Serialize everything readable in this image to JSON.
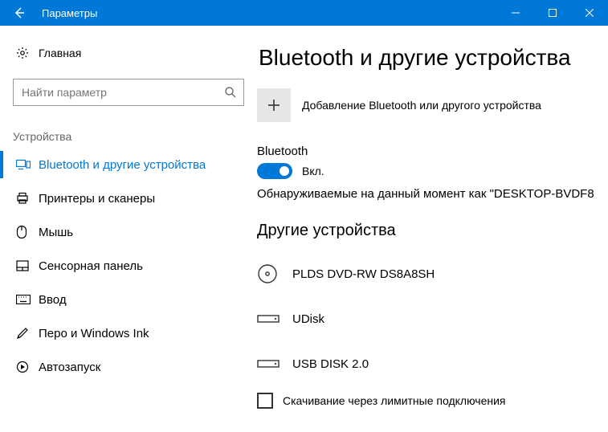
{
  "window": {
    "title": "Параметры"
  },
  "sidebar": {
    "home": "Главная",
    "search_placeholder": "Найти параметр",
    "category": "Устройства",
    "items": [
      {
        "label": "Bluetooth и другие устройства"
      },
      {
        "label": "Принтеры и сканеры"
      },
      {
        "label": "Мышь"
      },
      {
        "label": "Сенсорная панель"
      },
      {
        "label": "Ввод"
      },
      {
        "label": "Перо и Windows Ink"
      },
      {
        "label": "Автозапуск"
      }
    ]
  },
  "main": {
    "title": "Bluetooth и другие устройства",
    "add_label": "Добавление Bluetooth или другого устройства",
    "bt_label": "Bluetooth",
    "bt_state": "Вкл.",
    "discoverable": "Обнаруживаемые на данный момент как \"DESKTOP-BVDF8",
    "other_heading": "Другие устройства",
    "devices": [
      {
        "name": "PLDS DVD-RW DS8A8SH"
      },
      {
        "name": "UDisk"
      },
      {
        "name": "USB DISK 2.0"
      }
    ],
    "metered_label": "Скачивание через лимитные подключения"
  }
}
